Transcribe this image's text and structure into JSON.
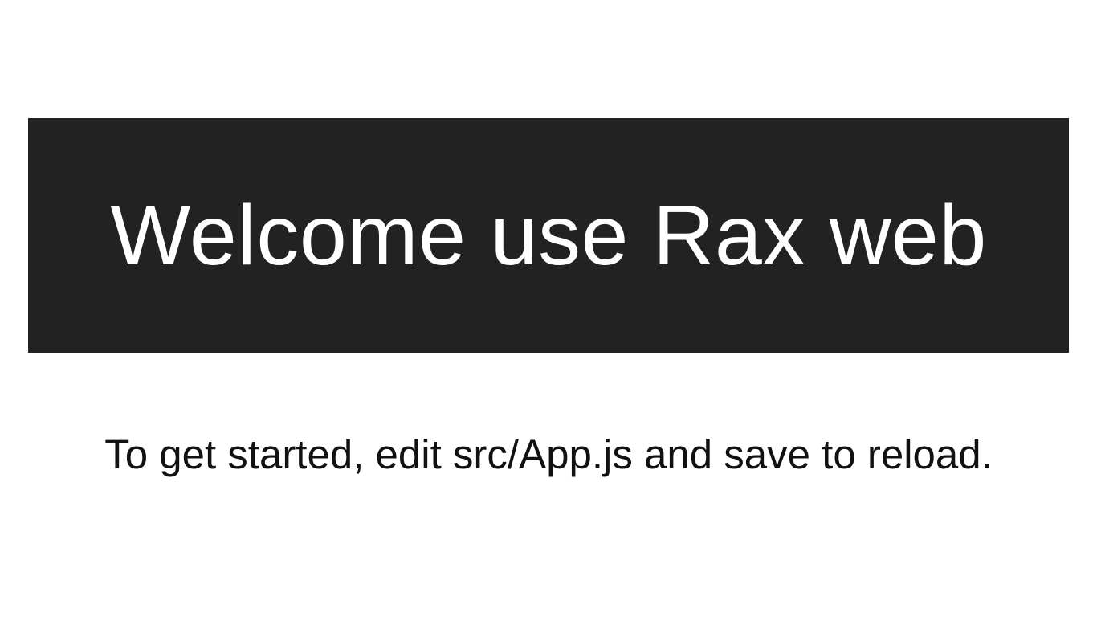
{
  "header": {
    "title": "Welcome use Rax web",
    "background_color": "#222222",
    "text_color": "#ffffff"
  },
  "intro": {
    "text": "To get started, edit src/App.js and save to reload."
  }
}
